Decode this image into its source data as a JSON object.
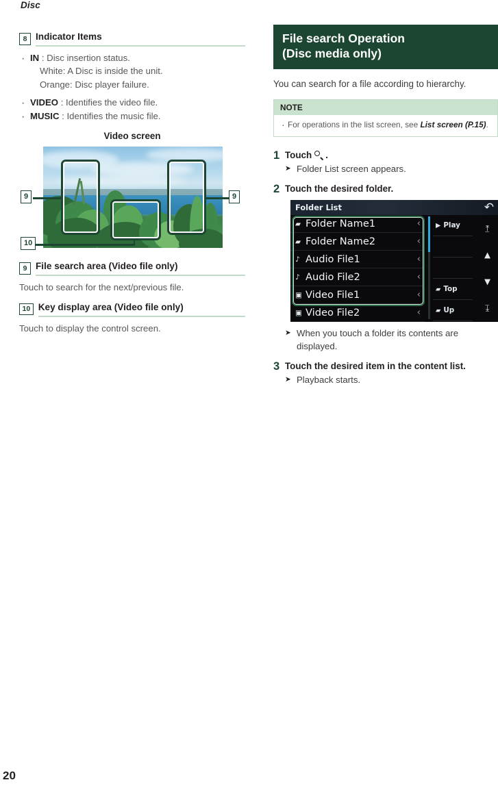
{
  "running_head": "Disc",
  "page_number": "20",
  "left_column": {
    "item8": {
      "badge": "8",
      "title": "Indicator Items",
      "bullets": [
        {
          "term": "IN",
          "rest": " : Disc insertion status.",
          "sub": [
            "White: A Disc is inside the unit.",
            "Orange: Disc player failure."
          ]
        },
        {
          "term": "VIDEO",
          "rest": " : Identifies the video file.",
          "sub": []
        },
        {
          "term": "MUSIC",
          "rest": " : Identifies the music file.",
          "sub": []
        }
      ]
    },
    "figure": {
      "caption": "Video screen",
      "badge_left": "9",
      "badge_right": "9",
      "badge_bottom": "10"
    },
    "item9": {
      "badge": "9",
      "title": "File search area (Video file only)",
      "body": "Touch to search for the next/previous file."
    },
    "item10": {
      "badge": "10",
      "title": "Key display area (Video file only)",
      "body": "Touch to display the control screen."
    }
  },
  "right_column": {
    "banner_line1": "File search Operation",
    "banner_line2": "(Disc media only)",
    "intro": "You can search for a file according to hierarchy.",
    "note": {
      "title": "NOTE",
      "text_before": "For operations in the list screen, see ",
      "text_link": "List screen (P.15)",
      "text_after": "."
    },
    "steps": [
      {
        "num": "1",
        "title_before": "Touch",
        "icon": "search-icon",
        "title_after": ".",
        "result": "Folder List screen appears."
      },
      {
        "num": "2",
        "title": "Touch the desired folder.",
        "result": "When you touch a folder its contents are displayed."
      },
      {
        "num": "3",
        "title": "Touch the desired item in the content list.",
        "result": "Playback starts."
      }
    ],
    "device_screenshot": {
      "title": "Folder List",
      "back_icon": "return-arrow-icon",
      "rows": [
        {
          "icon": "folder-icon",
          "glyph": "▰",
          "label": "Folder Name1",
          "chevron": "‹"
        },
        {
          "icon": "folder-icon",
          "glyph": "▰",
          "label": "Folder Name2",
          "chevron": "‹"
        },
        {
          "icon": "music-note-icon",
          "glyph": "♪",
          "label": "Audio File1",
          "chevron": "‹"
        },
        {
          "icon": "music-note-icon",
          "glyph": "♪",
          "label": "Audio File2",
          "chevron": "‹"
        },
        {
          "icon": "video-icon",
          "glyph": "▣",
          "label": "Video File1",
          "chevron": "‹"
        },
        {
          "icon": "video-icon",
          "glyph": "▣",
          "label": "Video File2",
          "chevron": "‹"
        }
      ],
      "side_buttons": [
        {
          "glyph": "▶",
          "label": "Play"
        },
        {
          "glyph": "",
          "label": ""
        },
        {
          "glyph": "",
          "label": ""
        },
        {
          "glyph": "▰",
          "label": "Top"
        },
        {
          "glyph": "▰",
          "label": "Up"
        }
      ],
      "nav_buttons": [
        {
          "name": "scroll-top-icon",
          "glyph": "⧉"
        },
        {
          "name": "scroll-up-icon",
          "glyph": "▲"
        },
        {
          "name": "scroll-down-icon",
          "glyph": "▼"
        },
        {
          "name": "scroll-bottom-icon",
          "glyph": "⧉"
        }
      ]
    }
  },
  "colors": {
    "dark_green": "#1d4632",
    "light_green": "#c2dac6",
    "note_green": "#c9e3ce",
    "accent_blue": "#2fa8e0"
  }
}
